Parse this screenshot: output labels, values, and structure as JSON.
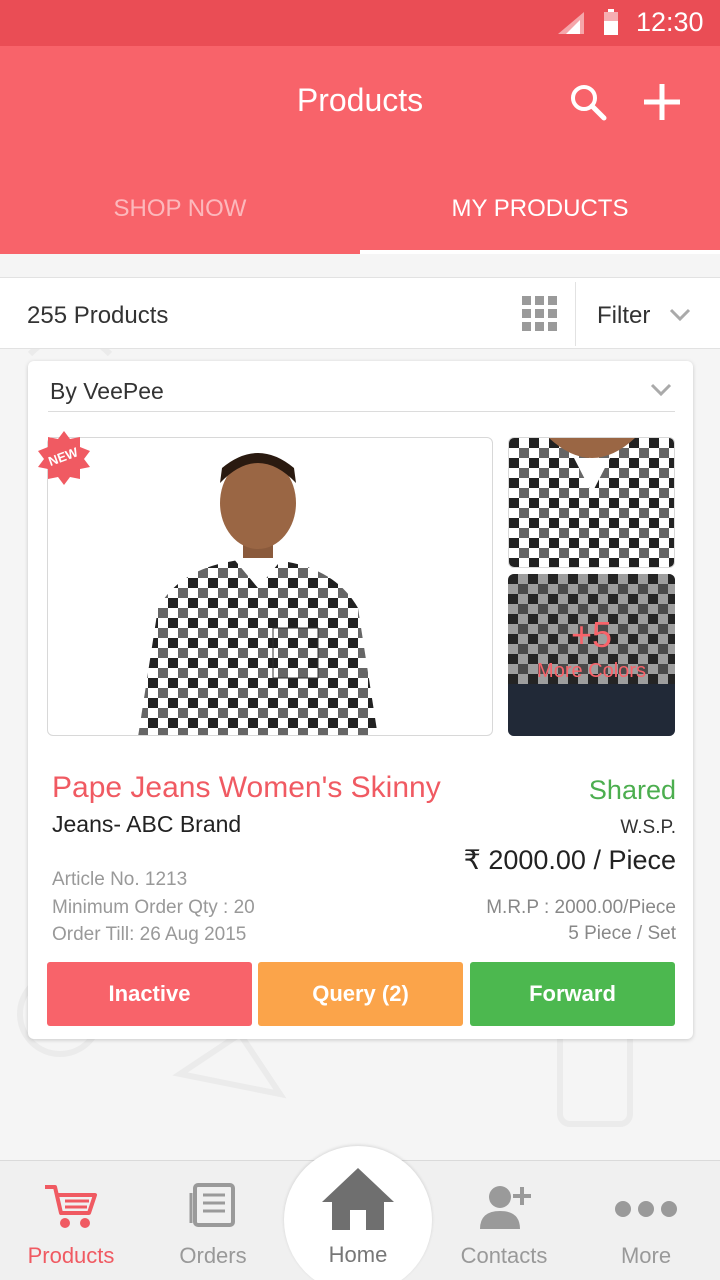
{
  "status_bar": {
    "time": "12:30",
    "icons": [
      "signal-icon",
      "battery-icon"
    ]
  },
  "app_bar": {
    "title": "Products",
    "actions": [
      "search-icon",
      "add-icon"
    ],
    "tabs": [
      {
        "label": "SHOP NOW",
        "active": false
      },
      {
        "label": "MY PRODUCTS",
        "active": true
      }
    ]
  },
  "toolbar": {
    "product_count": "255 Products",
    "view_icon": "grid-icon",
    "filter_label": "Filter"
  },
  "product": {
    "seller": "By VeePee",
    "badge": "NEW",
    "more": {
      "count": "+5",
      "label": "More Colors"
    },
    "title_line1": "Pape Jeans Women's Skinny",
    "title_line2": "Jeans- ABC Brand",
    "status": "Shared",
    "price_type": "W.S.P.",
    "price": "₹ 2000.00 / Piece",
    "article": "Article No. 1213",
    "min_order": "Minimum Order Qty : 20",
    "order_till": "Order Till: 26 Aug 2015",
    "mrp": "M.R.P : 2000.00/Piece",
    "set": "5 Piece / Set",
    "buttons": {
      "inactive": "Inactive",
      "query": "Query (2)",
      "forward": "Forward"
    }
  },
  "bottom_nav": {
    "products": "Products",
    "orders": "Orders",
    "home": "Home",
    "contacts": "Contacts",
    "more": "More"
  },
  "colors": {
    "primary": "#f8636a",
    "status_bar": "#ea4d55",
    "shared_green": "#4cae4f",
    "query_orange": "#fba44a",
    "forward_green": "#4cb84f"
  }
}
